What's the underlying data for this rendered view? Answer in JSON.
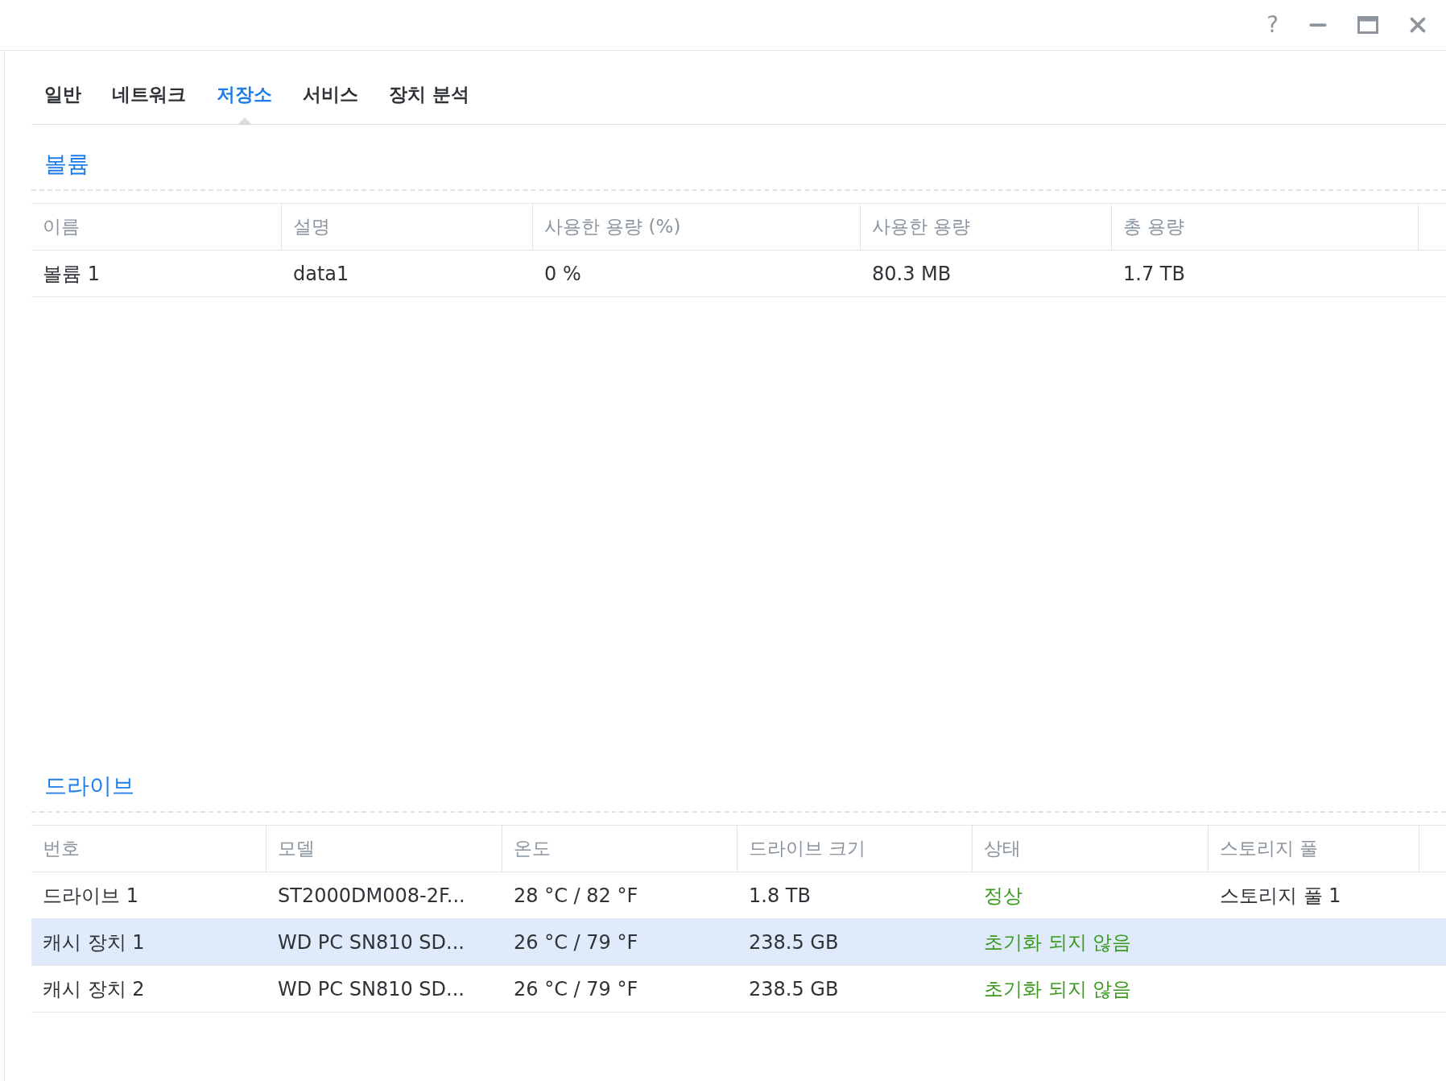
{
  "window": {
    "controls": [
      "?"
    ]
  },
  "tabs": [
    {
      "label": "일반",
      "selected": false
    },
    {
      "label": "네트워크",
      "selected": false
    },
    {
      "label": "저장소",
      "selected": true
    },
    {
      "label": "서비스",
      "selected": false
    },
    {
      "label": "장치 분석",
      "selected": false
    }
  ],
  "volumes": {
    "title": "볼륨",
    "columns": [
      "이름",
      "설명",
      "사용한 용량 (%)",
      "사용한 용량",
      "총 용량"
    ],
    "rows": [
      {
        "selected": false,
        "cells": [
          "볼륨 1",
          "data1",
          "0 %",
          "80.3 MB",
          "1.7 TB"
        ]
      }
    ]
  },
  "drives": {
    "title": "드라이브",
    "columns": [
      "번호",
      "모델",
      "온도",
      "드라이브 크기",
      "상태",
      "스토리지 풀"
    ],
    "rows": [
      {
        "selected": false,
        "cells": [
          "드라이브 1",
          "ST2000DM008-2F...",
          "28 °C / 82 °F",
          "1.8 TB",
          "정상",
          "스토리지 풀 1"
        ]
      },
      {
        "selected": true,
        "cells": [
          "캐시 장치 1",
          "WD PC SN810 SD...",
          "26 °C / 79 °F",
          "238.5 GB",
          "초기화 되지 않음",
          null
        ]
      },
      {
        "selected": false,
        "cells": [
          "캐시 장치 2",
          "WD PC SN810 SD...",
          "26 °C / 79 °F",
          "238.5 GB",
          "초기화 되지 않음",
          null
        ]
      }
    ]
  }
}
